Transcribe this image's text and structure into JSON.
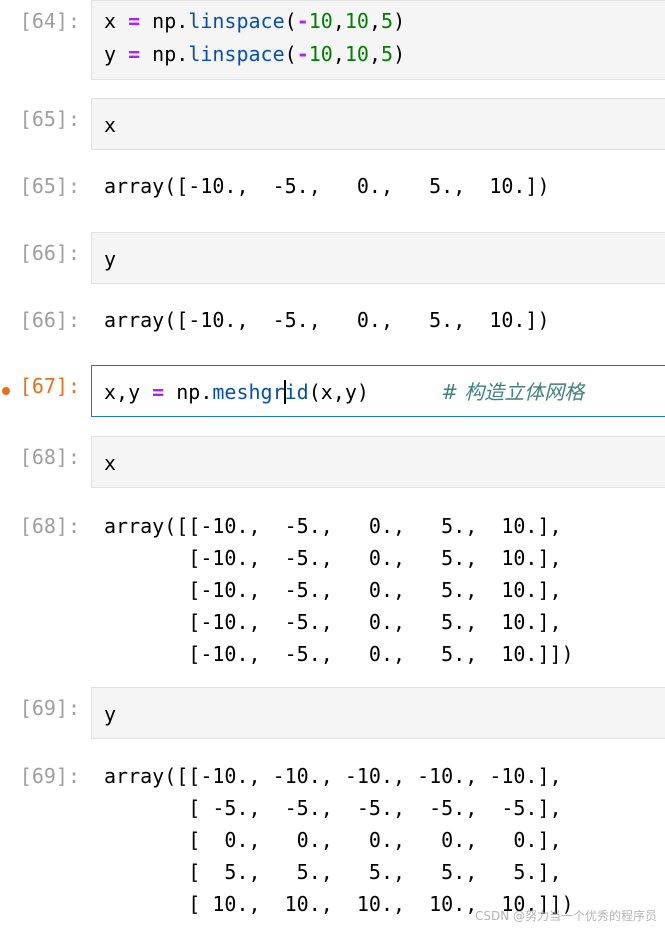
{
  "cells": [
    {
      "prompt": "[64]:",
      "type": "input",
      "lines": [
        [
          {
            "t": "x "
          },
          {
            "t": "=",
            "c": "op"
          },
          {
            "t": " np."
          },
          {
            "t": "linspace",
            "c": "fn"
          },
          {
            "t": "("
          },
          {
            "t": "-",
            "c": "op"
          },
          {
            "t": "10",
            "c": "num"
          },
          {
            "t": ","
          },
          {
            "t": "10",
            "c": "num"
          },
          {
            "t": ","
          },
          {
            "t": "5",
            "c": "num"
          },
          {
            "t": ")"
          }
        ],
        [
          {
            "t": "y "
          },
          {
            "t": "=",
            "c": "op"
          },
          {
            "t": " np."
          },
          {
            "t": "linspace",
            "c": "fn"
          },
          {
            "t": "("
          },
          {
            "t": "-",
            "c": "op"
          },
          {
            "t": "10",
            "c": "num"
          },
          {
            "t": ","
          },
          {
            "t": "10",
            "c": "num"
          },
          {
            "t": ","
          },
          {
            "t": "5",
            "c": "num"
          },
          {
            "t": ")"
          }
        ]
      ]
    },
    {
      "prompt": "[65]:",
      "type": "input",
      "lines": [
        [
          {
            "t": "x"
          }
        ]
      ]
    },
    {
      "prompt": "[65]:",
      "type": "output",
      "text": "array([-10.,  -5.,   0.,   5.,  10.])"
    },
    {
      "prompt": "[66]:",
      "type": "input",
      "lines": [
        [
          {
            "t": "y"
          }
        ]
      ]
    },
    {
      "prompt": "[66]:",
      "type": "output",
      "text": "array([-10.,  -5.,   0.,   5.,  10.])"
    },
    {
      "prompt": "[67]:",
      "type": "input",
      "active": true,
      "lines": [
        [
          {
            "t": "x,y "
          },
          {
            "t": "=",
            "c": "op"
          },
          {
            "t": " np."
          },
          {
            "t": "meshgr",
            "c": "fn"
          },
          {
            "t": "|",
            "c": "cursor"
          },
          {
            "t": "id",
            "c": "fn"
          },
          {
            "t": "(x,y)      "
          },
          {
            "t": "# 构造立体网格",
            "c": "cm"
          }
        ]
      ]
    },
    {
      "prompt": "[68]:",
      "type": "input",
      "lines": [
        [
          {
            "t": "x"
          }
        ]
      ]
    },
    {
      "prompt": "[68]:",
      "type": "output",
      "text": "array([[-10.,  -5.,   0.,   5.,  10.],\n       [-10.,  -5.,   0.,   5.,  10.],\n       [-10.,  -5.,   0.,   5.,  10.],\n       [-10.,  -5.,   0.,   5.,  10.],\n       [-10.,  -5.,   0.,   5.,  10.]])"
    },
    {
      "prompt": "[69]:",
      "type": "input",
      "lines": [
        [
          {
            "t": "y"
          }
        ]
      ]
    },
    {
      "prompt": "[69]:",
      "type": "output",
      "text": "array([[-10., -10., -10., -10., -10.],\n       [ -5.,  -5.,  -5.,  -5.,  -5.],\n       [  0.,   0.,   0.,   0.,   0.],\n       [  5.,   5.,   5.,   5.,   5.],\n       [ 10.,  10.,  10.,  10.,  10.]])"
    }
  ],
  "watermark": "CSDN @努力当一个优秀的程序员",
  "colors": {
    "keyword_operator": "#aa22ff",
    "function": "#0550ae",
    "number": "#008000",
    "comment": "#408080",
    "prompt": "#9e9e9e",
    "active_prompt": "#e8701a",
    "active_border": "#1976d2"
  }
}
